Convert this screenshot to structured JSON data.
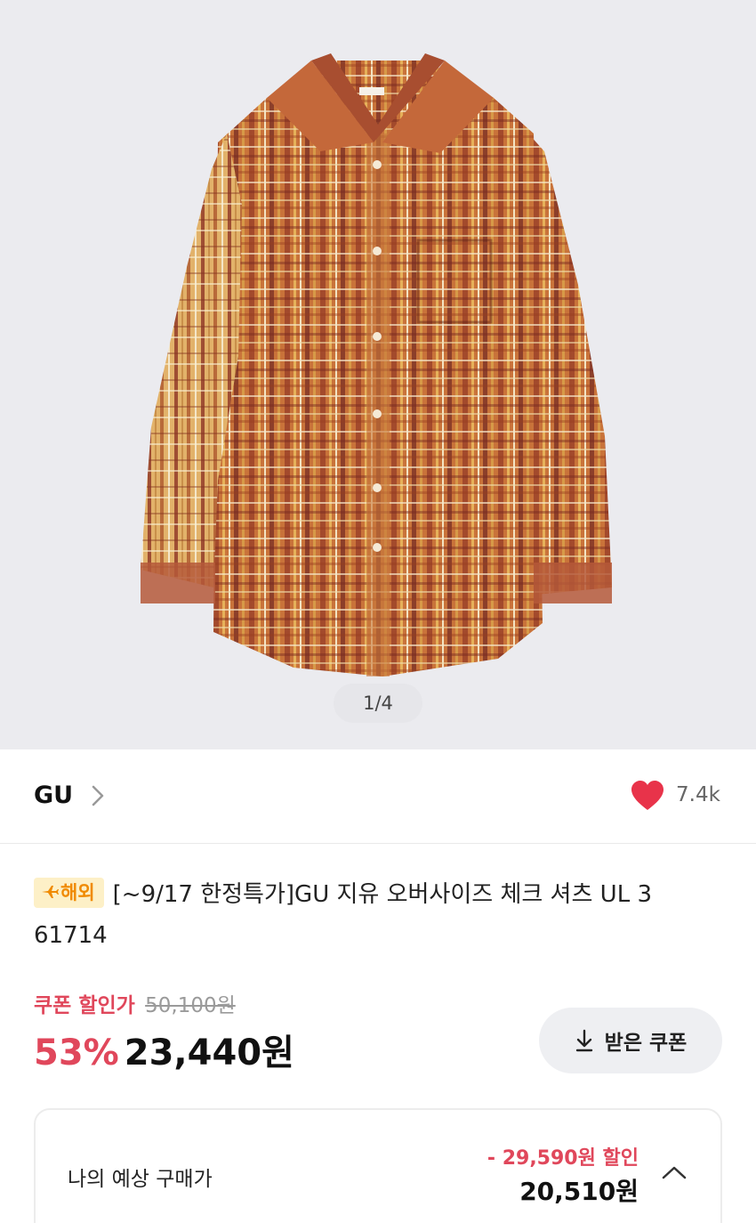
{
  "gallery": {
    "counter": "1/4",
    "image_name": "checked-shirt-photo"
  },
  "brand": {
    "name": "GU",
    "like_count": "7.4k"
  },
  "product": {
    "badge": "해외",
    "badge_icon": "airplane-icon",
    "title": "[~9/17 한정특가]GU 지유 오버사이즈 체크 셔츠 UL 3 61714"
  },
  "pricing": {
    "coupon_label": "쿠폰 할인가",
    "original_price": "50,100원",
    "discount_rate": "53%",
    "sale_price": "23,440원",
    "coupon_button": "받은 쿠폰"
  },
  "estimate": {
    "label": "나의 예상 구매가",
    "saving": "- 29,590원 할인",
    "price": "20,510원"
  },
  "colors": {
    "accent_red": "#e0475b",
    "badge_bg": "#fdf0c7",
    "badge_text": "#f08a00",
    "heart": "#e8334a"
  }
}
